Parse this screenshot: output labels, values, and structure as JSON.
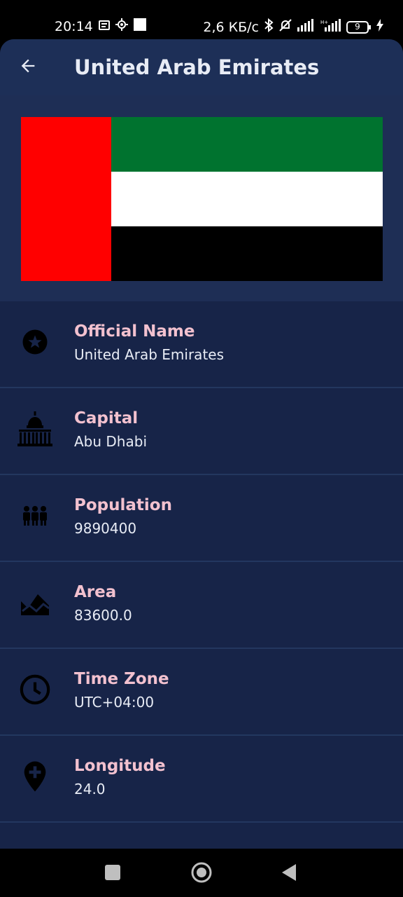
{
  "status_bar": {
    "time": "20:14",
    "speed": "2,6 КБ/с",
    "battery": "9"
  },
  "header": {
    "title": "United Arab Emirates"
  },
  "flag": {
    "colors": [
      "#ff0000",
      "#00732f",
      "#ffffff",
      "#000000"
    ]
  },
  "details": [
    {
      "icon": "star-badge-icon",
      "label": "Official Name",
      "value": "United Arab Emirates"
    },
    {
      "icon": "capitol-building-icon",
      "label": "Capital",
      "value": "Abu Dhabi"
    },
    {
      "icon": "people-icon",
      "label": "Population",
      "value": "9890400"
    },
    {
      "icon": "terrain-icon",
      "label": "Area",
      "value": "83600.0"
    },
    {
      "icon": "clock-icon",
      "label": "Time Zone",
      "value": "UTC+04:00"
    },
    {
      "icon": "location-pin-icon",
      "label": "Longitude",
      "value": "24.0"
    }
  ]
}
